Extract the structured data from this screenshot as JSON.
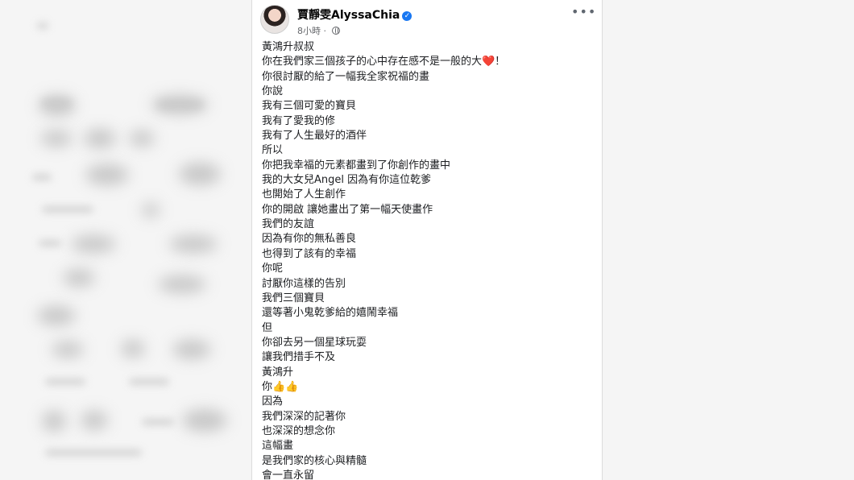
{
  "post": {
    "author": "賈靜雯AlyssaChia",
    "verified_badge": "verified-icon",
    "time": "8小時",
    "separator": "·",
    "privacy": "globe-icon",
    "more_menu": "•••",
    "lines": [
      "黃鴻升叔叔",
      "你在我們家三個孩子的心中存在感不是一般的大❤️！",
      "你很討厭的給了一幅我全家祝福的畫",
      "你說",
      "我有三個可愛的寶貝",
      "我有了愛我的修",
      "我有了人生最好的酒伴",
      "所以",
      "你把我幸福的元素都畫到了你創作的畫中",
      "我的大女兒Angel 因為有你這位乾爹",
      "也開始了人生創作",
      "你的開啟 讓她畫出了第一幅天使畫作",
      "我們的友誼",
      "因為有你的無私善良",
      "也得到了該有的幸福",
      "你呢",
      "討厭你這樣的告別",
      "我們三個寶貝",
      "還等著小鬼乾爹給的嬉鬧幸福",
      "但",
      "你卻去另一個星球玩耍",
      "讓我們措手不及",
      "黃鴻升",
      "你👍👍",
      "因為",
      "我們深深的記著你",
      "也深深的想念你",
      "這幅畫",
      "是我們家的核心與精髓",
      "會一直永留"
    ]
  }
}
